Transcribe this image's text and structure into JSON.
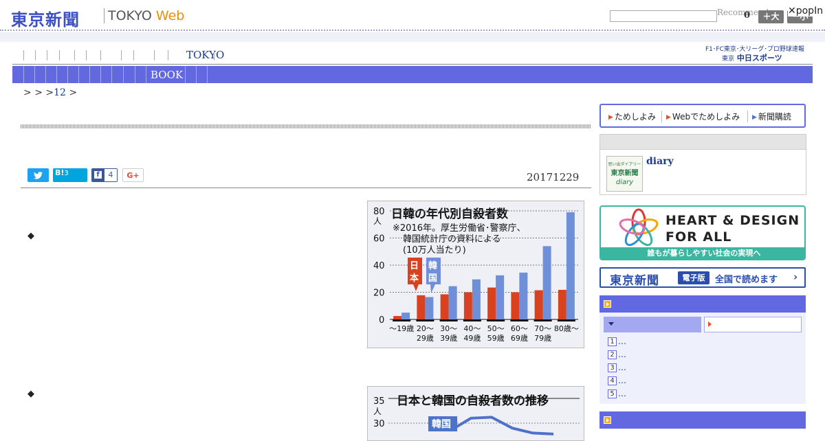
{
  "header": {
    "logo": "東京新聞",
    "logo_sub": "TOKYO",
    "logo_web": "Web",
    "recommend": "Recommend",
    "recommend_count": "0",
    "size_up": "＋大",
    "size_down": "－小",
    "popin": "✕popIn"
  },
  "nav": {
    "primary_active": "TOKYO",
    "partner_line1": "F1･FC東京･大リーグ･プロ野球速報",
    "partner_line2_small": "東京",
    "partner_line2": "中日スポーツ",
    "section_active": "BOOK"
  },
  "breadcrumb": {
    "sep1": ">",
    "sep2": ">",
    "sep3": ">",
    "page": "12",
    "sep4": ">"
  },
  "article": {
    "date": "20171229",
    "bullet1": "◆",
    "bullet2": "◆",
    "share": {
      "twitter_icon": "twitter-icon",
      "hatena_label": "B!",
      "hatena_count": "3",
      "facebook_count": "4",
      "google_label": "G+"
    }
  },
  "figure1": {
    "title": "日韓の年代別自殺者数",
    "note_line1": "※2016年。厚生労働省･警察庁、",
    "note_line2": "韓国統計庁の資料による",
    "note_line3": "(10万人当たり)",
    "legend_japan": "日本",
    "legend_korea": "韓国",
    "unit": "人",
    "colors": {
      "japan": "#d9421e",
      "korea": "#6f8fd8"
    }
  },
  "figure2": {
    "title": "日本と韓国の自殺者数の推移",
    "unit": "人",
    "tick_35": "35",
    "tick_30": "30",
    "label_korea": "韓国"
  },
  "chart_data": [
    {
      "type": "bar",
      "title": "日韓の年代別自殺者数",
      "subtitle": "※2016年。厚生労働省･警察庁、韓国統計庁の資料による(10万人当たり)",
      "ylabel": "人",
      "ylim": [
        0,
        80
      ],
      "yticks": [
        0,
        20,
        40,
        60,
        80
      ],
      "categories": [
        "〜19歳",
        "20〜29歳",
        "30〜39歳",
        "40〜49歳",
        "50〜59歳",
        "60〜69歳",
        "70〜79歳",
        "80歳〜"
      ],
      "category_line1": [
        "〜19歳",
        "20〜",
        "30〜",
        "40〜",
        "50〜",
        "60〜",
        "70〜",
        "80歳〜"
      ],
      "category_line2": [
        "",
        "29歳",
        "39歳",
        "49歳",
        "59歳",
        "69歳",
        "79歳",
        ""
      ],
      "series": [
        {
          "name": "日本",
          "values": [
            2.5,
            17.8,
            18.5,
            20.0,
            23.5,
            20.0,
            21.5,
            21.8
          ]
        },
        {
          "name": "韓国",
          "values": [
            5.0,
            16.5,
            24.5,
            29.5,
            32.5,
            34.5,
            54.0,
            79.0
          ]
        }
      ],
      "legend": "inside-left",
      "grid": true
    },
    {
      "type": "line",
      "title": "日本と韓国の自殺者数の推移",
      "ylabel": "人",
      "yticks_visible": [
        30,
        35
      ],
      "series": [
        {
          "name": "韓国",
          "values": [
            28.5,
            31.0,
            31.2,
            29.0,
            28.0,
            27.8
          ]
        }
      ]
    }
  ],
  "sidebar": {
    "promo1": "ためしよみ",
    "promo2": "Webでためしよみ",
    "promo3": "新聞購読",
    "diary_title": "diary",
    "diary_thumb_line1": "思い出ダイアリー",
    "diary_thumb_line2": "東京新聞",
    "diary_thumb_line3": "diary",
    "heart_line1": "HEART & DESIGN",
    "heart_line2": "FOR ALL",
    "heart_footer": "誰もが暮らしやすい社会の実現へ",
    "digital_logo": "東京新聞",
    "digital_badge": "電子版",
    "digital_text": "全国で読めます",
    "digital_arrow": "›",
    "ranking": [
      "1…",
      "2…",
      "3…",
      "4…",
      "5…"
    ]
  }
}
